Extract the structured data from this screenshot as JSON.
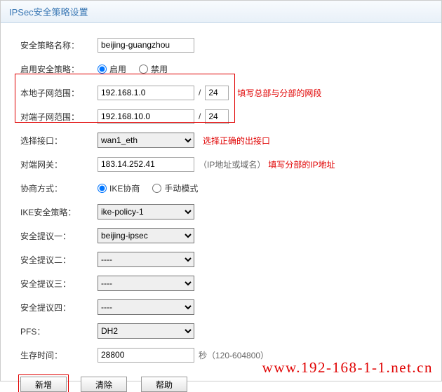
{
  "title": "IPSec安全策略设置",
  "labels": {
    "policy_name": "安全策略名称：",
    "enable_policy": "启用安全策略：",
    "local_subnet": "本地子网范围：",
    "remote_subnet": "对端子网范围：",
    "interface": "选择接口：",
    "remote_gw": "对端网关：",
    "nego_mode": "协商方式：",
    "ike_policy": "IKE安全策略：",
    "proposal1": "安全提议一：",
    "proposal2": "安全提议二：",
    "proposal3": "安全提议三：",
    "proposal4": "安全提议四：",
    "pfs": "PFS：",
    "lifetime": "生存时间："
  },
  "values": {
    "policy_name": "beijing-guangzhou",
    "local_subnet_ip": "192.168.1.0",
    "local_subnet_mask": "24",
    "remote_subnet_ip": "192.168.10.0",
    "remote_subnet_mask": "24",
    "interface": "wan1_eth",
    "remote_gw": "183.14.252.41",
    "ike_policy": "ike-policy-1",
    "proposal1": "beijing-ipsec",
    "proposal2": "----",
    "proposal3": "----",
    "proposal4": "----",
    "pfs": "DH2",
    "lifetime": "28800"
  },
  "radios": {
    "enable": "启用",
    "disable": "禁用",
    "ike": "IKE协商",
    "manual": "手动模式"
  },
  "hints": {
    "subnet": "填写总部与分部的网段",
    "interface": "选择正确的出接口",
    "remote_gw_gray": "（IP地址或域名）",
    "remote_gw_red": "填写分部的IP地址",
    "lifetime": "秒（120-604800）"
  },
  "buttons": {
    "add": "新增",
    "clear": "清除",
    "help": "帮助"
  },
  "watermark": "www.192-168-1-1.net.cn"
}
